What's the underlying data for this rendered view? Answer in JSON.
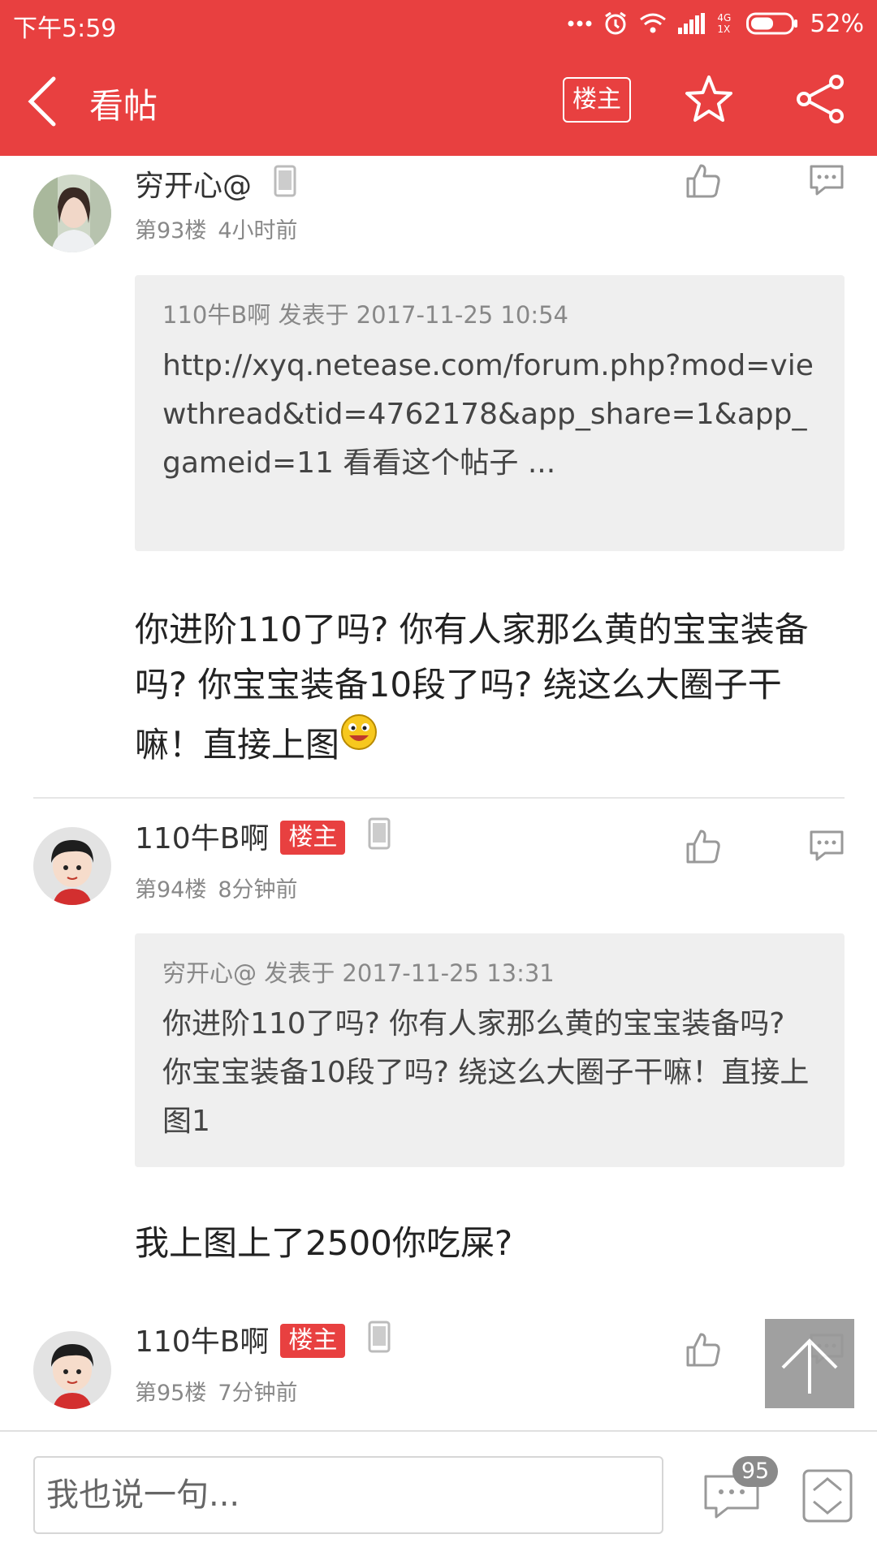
{
  "status_bar": {
    "time": "下午5:59",
    "network": "4G 1X",
    "battery": "52%"
  },
  "nav": {
    "title": "看帖",
    "op_only_label": "楼主"
  },
  "posts": [
    {
      "username": "穷开心@",
      "floor": "第93楼",
      "time": "4小时前",
      "quote": {
        "header": "110牛B啊 发表于 2017-11-25 10:54",
        "text": "http://xyq.netease.com/forum.php?mod=viewthread&tid=4762178&app_share=1&app_gameid=11 看看这个帖子 ..."
      },
      "body": "你进阶110了吗? 你有人家那么黄的宝宝装备吗? 你宝宝装备10段了吗? 绕这么大圈子干嘛！直接上图"
    },
    {
      "username": "110牛B啊",
      "badge": "楼主",
      "floor": "第94楼",
      "time": "8分钟前",
      "quote": {
        "header": "穷开心@ 发表于 2017-11-25 13:31",
        "text": "你进阶110了吗? 你有人家那么黄的宝宝装备吗? 你宝宝装备10段了吗? 绕这么大圈子干嘛！直接上图1"
      },
      "body": "我上图上了2500你吃屎?"
    },
    {
      "username": "110牛B啊",
      "badge": "楼主",
      "floor": "第95楼",
      "time": "7分钟前"
    }
  ],
  "bottom_bar": {
    "input_placeholder": "我也说一句...",
    "comment_count": "95"
  },
  "colors": {
    "brand_red": "#e84040",
    "quote_bg": "#efefef"
  }
}
